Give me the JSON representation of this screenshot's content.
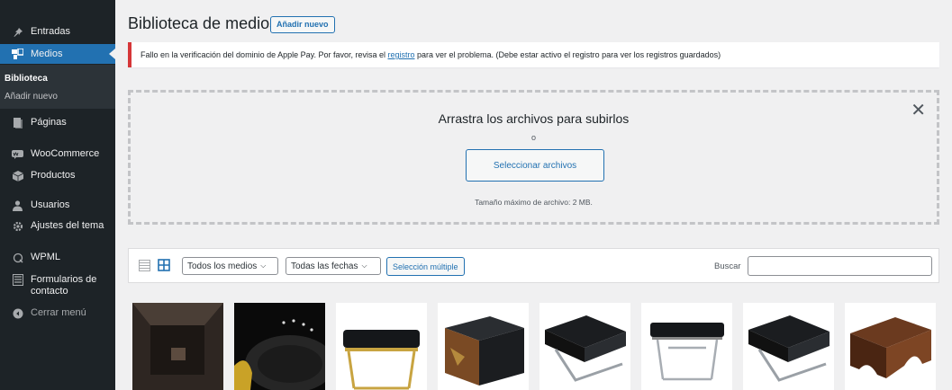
{
  "sidebar": {
    "items": [
      {
        "label": "Entradas",
        "icon": "pushpin-icon"
      },
      {
        "label": "Medios",
        "icon": "media-icon"
      },
      {
        "label": "Páginas",
        "icon": "page-icon"
      },
      {
        "label": "WooCommerce",
        "icon": "woocommerce-icon"
      },
      {
        "label": "Productos",
        "icon": "box-icon"
      },
      {
        "label": "Usuarios",
        "icon": "user-icon"
      },
      {
        "label": "Ajustes del tema",
        "icon": "gear-icon"
      },
      {
        "label": "WPML",
        "icon": "wpml-icon"
      },
      {
        "label": "Formularios de contacto",
        "icon": "form-icon"
      },
      {
        "label": "Cerrar menú",
        "icon": "collapse-icon"
      }
    ],
    "submenu": [
      {
        "label": "Biblioteca"
      },
      {
        "label": "Añadir nuevo"
      }
    ]
  },
  "header": {
    "title": "Biblioteca de medios",
    "add_new": "Añadir nuevo"
  },
  "notice": {
    "before": "Fallo en la verificación del dominio de Apple Pay. Por favor, revisa el ",
    "link": "registro",
    "after": " para ver el problema. (Debe estar activo el registro para ver los registros guardados)"
  },
  "upload": {
    "title": "Arrastra los archivos para subirlos",
    "or": "o",
    "button": "Seleccionar archivos",
    "max_size": "Tamaño máximo de archivo: 2 MB."
  },
  "toolbar": {
    "media_filter": "Todos los medios",
    "date_filter": "Todas las fechas",
    "bulk_select": "Selección múltiple",
    "search_label": "Buscar",
    "search_value": ""
  },
  "colors": {
    "sidebar": "#1d2327",
    "accent": "#2271b1",
    "error": "#d63638"
  }
}
